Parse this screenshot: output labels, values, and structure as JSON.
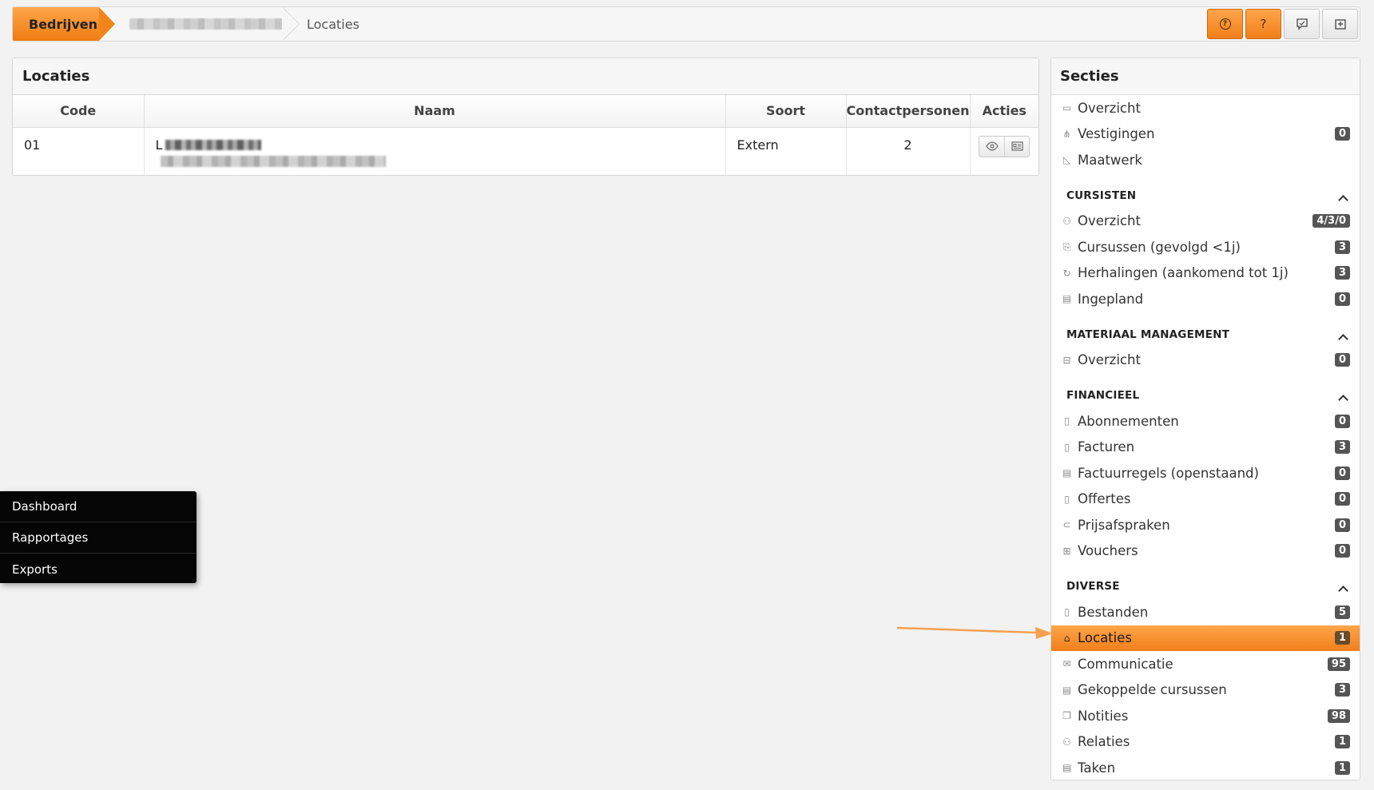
{
  "breadcrumb": {
    "first": "Bedrijven",
    "current": "Locaties"
  },
  "top_actions": [
    {
      "icon": "help-circle-icon"
    },
    {
      "icon": "question-icon",
      "glyph": "?"
    },
    {
      "icon": "chat-icon"
    },
    {
      "icon": "export-icon"
    }
  ],
  "locaties": {
    "title": "Locaties",
    "columns": [
      "Code",
      "Naam",
      "Soort",
      "Contactpersonen",
      "Acties"
    ],
    "rows": [
      {
        "code": "01",
        "naam_prefix": "L",
        "soort": "Extern",
        "contactpersonen": "2"
      }
    ]
  },
  "secties": {
    "title": "Secties",
    "top_items": [
      {
        "label": "Overzicht",
        "icon": "overview-icon",
        "badge": ""
      },
      {
        "label": "Vestigingen",
        "icon": "branch-icon",
        "badge": "0"
      },
      {
        "label": "Maatwerk",
        "icon": "custom-icon",
        "badge": ""
      }
    ],
    "groups": [
      {
        "title": "CURSISTEN",
        "items": [
          {
            "label": "Overzicht",
            "icon": "users-icon",
            "badge": "4/3/0"
          },
          {
            "label": "Cursussen (gevolgd <1j)",
            "icon": "course-icon",
            "badge": "3"
          },
          {
            "label": "Herhalingen (aankomend tot 1j)",
            "icon": "refresh-icon",
            "badge": "3"
          },
          {
            "label": "Ingepland",
            "icon": "calendar-icon",
            "badge": "0"
          }
        ]
      },
      {
        "title": "MATERIAAL MANAGEMENT",
        "items": [
          {
            "label": "Overzicht",
            "icon": "box-icon",
            "badge": "0"
          }
        ]
      },
      {
        "title": "FINANCIEEL",
        "items": [
          {
            "label": "Abonnementen",
            "icon": "document-icon",
            "badge": "0"
          },
          {
            "label": "Facturen",
            "icon": "invoice-icon",
            "badge": "3"
          },
          {
            "label": "Factuurregels (openstaand)",
            "icon": "list-icon",
            "badge": "0"
          },
          {
            "label": "Offertes",
            "icon": "quote-icon",
            "badge": "0"
          },
          {
            "label": "Prijsafspraken",
            "icon": "handshake-icon",
            "badge": "0"
          },
          {
            "label": "Vouchers",
            "icon": "gift-icon",
            "badge": "0"
          }
        ]
      },
      {
        "title": "DIVERSE",
        "items": [
          {
            "label": "Bestanden",
            "icon": "file-icon",
            "badge": "5",
            "active": false
          },
          {
            "label": "Locaties",
            "icon": "location-icon",
            "badge": "1",
            "active": true
          },
          {
            "label": "Communicatie",
            "icon": "mail-icon",
            "badge": "95",
            "active": false
          },
          {
            "label": "Gekoppelde cursussen",
            "icon": "linked-course-icon",
            "badge": "3",
            "active": false
          },
          {
            "label": "Notities",
            "icon": "notes-icon",
            "badge": "98",
            "active": false
          },
          {
            "label": "Relaties",
            "icon": "relations-icon",
            "badge": "1",
            "active": false
          },
          {
            "label": "Taken",
            "icon": "tasks-icon",
            "badge": "1",
            "active": false
          }
        ]
      }
    ]
  },
  "float_menu": [
    "Dashboard",
    "Rapportages",
    "Exports"
  ],
  "colors": {
    "accent": "#f28518",
    "badge": "#555555",
    "float_menu_bg": "#050505"
  }
}
